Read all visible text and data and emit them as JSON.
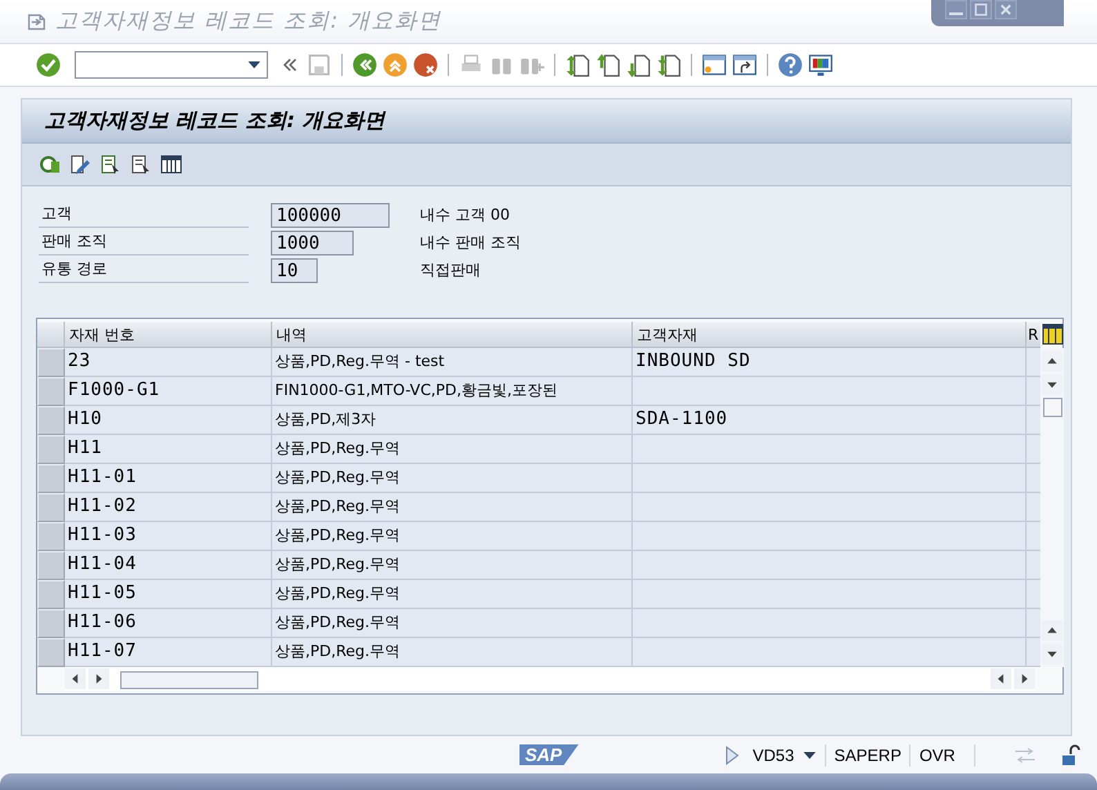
{
  "window": {
    "title": "고객자재정보 레코드 조회: 개요화면"
  },
  "panel": {
    "title": "고객자재정보 레코드 조회: 개요화면"
  },
  "fields": [
    {
      "label": "고객",
      "value": "100000",
      "description": "내수 고객 00"
    },
    {
      "label": "판매 조직",
      "value": "1000",
      "description": "내수 판매 조직"
    },
    {
      "label": "유통 경로",
      "value": "10",
      "description": "직접판매"
    }
  ],
  "table": {
    "columns": [
      "자재 번호",
      "내역",
      "고객자재",
      "R"
    ],
    "rows": [
      {
        "material": "23",
        "description": "상품,PD,Reg.무역 - test",
        "customer_material": "INBOUND SD"
      },
      {
        "material": "F1000-G1",
        "description": "FIN1000-G1,MTO-VC,PD,황금빛,포장된"
      },
      {
        "material": "H10",
        "description": "상품,PD,제3자",
        "customer_material": "SDA-1100"
      },
      {
        "material": "H11",
        "description": "상품,PD,Reg.무역"
      },
      {
        "material": "H11-01",
        "description": "상품,PD,Reg.무역"
      },
      {
        "material": "H11-02",
        "description": "상품,PD,Reg.무역"
      },
      {
        "material": "H11-03",
        "description": "상품,PD,Reg.무역"
      },
      {
        "material": "H11-04",
        "description": "상품,PD,Reg.무역"
      },
      {
        "material": "H11-05",
        "description": "상품,PD,Reg.무역"
      },
      {
        "material": "H11-06",
        "description": "상품,PD,Reg.무역"
      },
      {
        "material": "H11-07",
        "description": "상품,PD,Reg.무역"
      }
    ]
  },
  "status_bar": {
    "logo_text": "SAP",
    "transaction": "VD53",
    "system": "SAPERP",
    "mode": "OVR"
  }
}
